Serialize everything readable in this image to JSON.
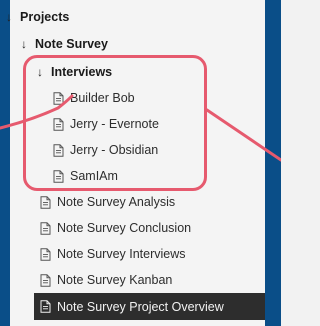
{
  "tree": {
    "root": {
      "label": "Projects"
    },
    "project": {
      "label": "Note Survey"
    },
    "folder": {
      "label": "Interviews"
    },
    "interviews": [
      {
        "label": "Builder Bob"
      },
      {
        "label": "Jerry - Evernote"
      },
      {
        "label": "Jerry - Obsidian"
      },
      {
        "label": "SamIAm"
      }
    ],
    "notes": [
      {
        "label": "Note Survey Analysis"
      },
      {
        "label": "Note Survey Conclusion"
      },
      {
        "label": "Note Survey Interviews"
      },
      {
        "label": "Note Survey Kanban"
      },
      {
        "label": "Note Survey Project Overview",
        "active": true
      }
    ]
  },
  "colors": {
    "frame": "#0a4e88",
    "panel": "#f4f4f4",
    "annotation": "#e65a6e",
    "active_row": "#2d2d2d"
  },
  "icons": {
    "expand": "chevron-down-icon",
    "file": "document-icon"
  }
}
